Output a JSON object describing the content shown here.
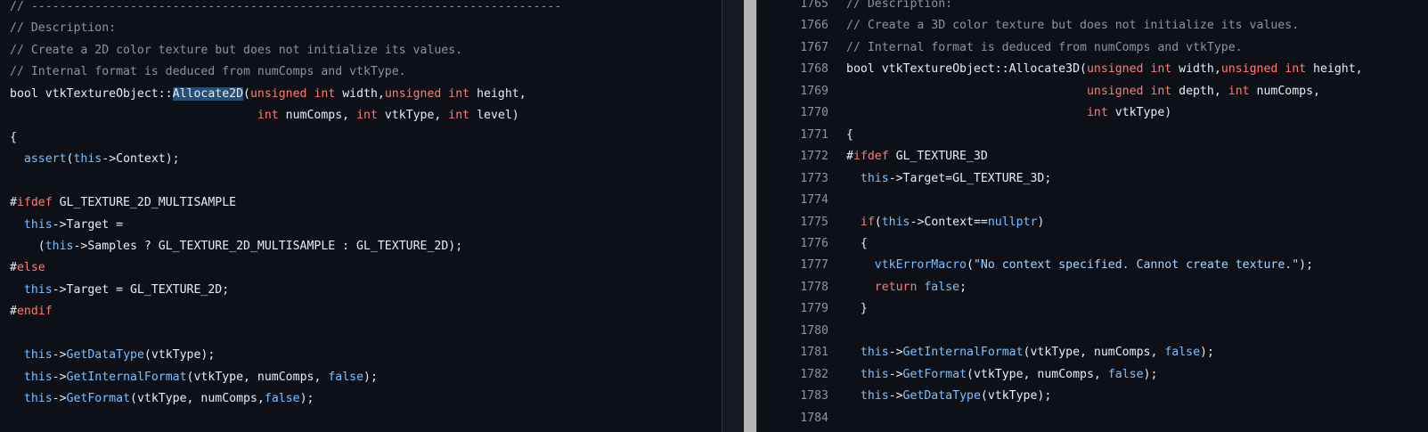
{
  "left_editor": {
    "lines": [
      [
        {
          "t": "// ---------------------------------------------------------------------------",
          "c": "cm"
        }
      ],
      [
        {
          "t": "// Description:",
          "c": "cm"
        }
      ],
      [
        {
          "t": "// Create a 2D color texture but does not initialize its values.",
          "c": "cm"
        }
      ],
      [
        {
          "t": "// Internal format is deduced from numComps and vtkType.",
          "c": "cm"
        }
      ],
      [
        {
          "t": "bool vtkTextureObject::",
          "c": "pl"
        },
        {
          "t": "Allocate2D",
          "c": "hl"
        },
        {
          "t": "(",
          "c": "pl"
        },
        {
          "t": "unsigned int",
          "c": "kw"
        },
        {
          "t": " width,",
          "c": "pl"
        },
        {
          "t": "unsigned int",
          "c": "kw"
        },
        {
          "t": " height,",
          "c": "pl"
        }
      ],
      [
        {
          "t": "                                   ",
          "c": "pl"
        },
        {
          "t": "int",
          "c": "kw"
        },
        {
          "t": " numComps, ",
          "c": "pl"
        },
        {
          "t": "int",
          "c": "kw"
        },
        {
          "t": " vtkType, ",
          "c": "pl"
        },
        {
          "t": "int",
          "c": "kw"
        },
        {
          "t": " level)",
          "c": "pl"
        }
      ],
      [
        {
          "t": "{",
          "c": "pl"
        }
      ],
      [
        {
          "t": "  ",
          "c": "pl"
        },
        {
          "t": "assert",
          "c": "fn"
        },
        {
          "t": "(",
          "c": "pl"
        },
        {
          "t": "this",
          "c": "th"
        },
        {
          "t": "->Context);",
          "c": "pl"
        }
      ],
      [
        {
          "t": "",
          "c": "pl"
        }
      ],
      [
        {
          "t": "#",
          "c": "pl"
        },
        {
          "t": "ifdef",
          "c": "kw"
        },
        {
          "t": " GL_TEXTURE_2D_MULTISAMPLE",
          "c": "pl"
        }
      ],
      [
        {
          "t": "  ",
          "c": "pl"
        },
        {
          "t": "this",
          "c": "th"
        },
        {
          "t": "->Target =",
          "c": "pl"
        }
      ],
      [
        {
          "t": "    (",
          "c": "pl"
        },
        {
          "t": "this",
          "c": "th"
        },
        {
          "t": "->Samples ? GL_TEXTURE_2D_MULTISAMPLE : GL_TEXTURE_2D);",
          "c": "pl"
        }
      ],
      [
        {
          "t": "#",
          "c": "pl"
        },
        {
          "t": "else",
          "c": "kw"
        }
      ],
      [
        {
          "t": "  ",
          "c": "pl"
        },
        {
          "t": "this",
          "c": "th"
        },
        {
          "t": "->Target = GL_TEXTURE_2D;",
          "c": "pl"
        }
      ],
      [
        {
          "t": "#",
          "c": "pl"
        },
        {
          "t": "endif",
          "c": "kw"
        }
      ],
      [
        {
          "t": "",
          "c": "pl"
        }
      ],
      [
        {
          "t": "  ",
          "c": "pl"
        },
        {
          "t": "this",
          "c": "th"
        },
        {
          "t": "->",
          "c": "pl"
        },
        {
          "t": "GetDataType",
          "c": "fn"
        },
        {
          "t": "(vtkType);",
          "c": "pl"
        }
      ],
      [
        {
          "t": "  ",
          "c": "pl"
        },
        {
          "t": "this",
          "c": "th"
        },
        {
          "t": "->",
          "c": "pl"
        },
        {
          "t": "GetInternalFormat",
          "c": "fn"
        },
        {
          "t": "(vtkType, numComps, ",
          "c": "pl"
        },
        {
          "t": "false",
          "c": "th"
        },
        {
          "t": ");",
          "c": "pl"
        }
      ],
      [
        {
          "t": "  ",
          "c": "pl"
        },
        {
          "t": "this",
          "c": "th"
        },
        {
          "t": "->",
          "c": "pl"
        },
        {
          "t": "GetFormat",
          "c": "fn"
        },
        {
          "t": "(vtkType, numComps,",
          "c": "pl"
        },
        {
          "t": "false",
          "c": "th"
        },
        {
          "t": ");",
          "c": "pl"
        }
      ]
    ]
  },
  "right_editor": {
    "lines": [
      {
        "n": "1765",
        "code": [
          {
            "t": "// Description:",
            "c": "cm"
          }
        ]
      },
      {
        "n": "1766",
        "code": [
          {
            "t": "// Create a 3D color texture but does not initialize its values.",
            "c": "cm"
          }
        ]
      },
      {
        "n": "1767",
        "code": [
          {
            "t": "// Internal format is deduced from numComps and vtkType.",
            "c": "cm"
          }
        ]
      },
      {
        "n": "1768",
        "code": [
          {
            "t": "bool vtkTextureObject::Allocate3D(",
            "c": "pl"
          },
          {
            "t": "unsigned int",
            "c": "kw"
          },
          {
            "t": " width,",
            "c": "pl"
          },
          {
            "t": "unsigned int",
            "c": "kw"
          },
          {
            "t": " height,",
            "c": "pl"
          }
        ]
      },
      {
        "n": "1769",
        "code": [
          {
            "t": "                                  ",
            "c": "pl"
          },
          {
            "t": "unsigned int",
            "c": "kw"
          },
          {
            "t": " depth, ",
            "c": "pl"
          },
          {
            "t": "int",
            "c": "kw"
          },
          {
            "t": " numComps,",
            "c": "pl"
          }
        ]
      },
      {
        "n": "1770",
        "code": [
          {
            "t": "                                  ",
            "c": "pl"
          },
          {
            "t": "int",
            "c": "kw"
          },
          {
            "t": " vtkType)",
            "c": "pl"
          }
        ]
      },
      {
        "n": "1771",
        "code": [
          {
            "t": "{",
            "c": "pl"
          }
        ]
      },
      {
        "n": "1772",
        "code": [
          {
            "t": "#",
            "c": "pl"
          },
          {
            "t": "ifdef",
            "c": "kw"
          },
          {
            "t": " GL_TEXTURE_3D",
            "c": "pl"
          }
        ]
      },
      {
        "n": "1773",
        "code": [
          {
            "t": "  ",
            "c": "pl"
          },
          {
            "t": "this",
            "c": "th"
          },
          {
            "t": "->Target=GL_TEXTURE_3D;",
            "c": "pl"
          }
        ]
      },
      {
        "n": "1774",
        "code": [
          {
            "t": "",
            "c": "pl"
          }
        ]
      },
      {
        "n": "1775",
        "code": [
          {
            "t": "  ",
            "c": "pl"
          },
          {
            "t": "if",
            "c": "kw"
          },
          {
            "t": "(",
            "c": "pl"
          },
          {
            "t": "this",
            "c": "th"
          },
          {
            "t": "->Context==",
            "c": "pl"
          },
          {
            "t": "nullptr",
            "c": "th"
          },
          {
            "t": ")",
            "c": "pl"
          }
        ]
      },
      {
        "n": "1776",
        "code": [
          {
            "t": "  {",
            "c": "pl"
          }
        ]
      },
      {
        "n": "1777",
        "code": [
          {
            "t": "    ",
            "c": "pl"
          },
          {
            "t": "vtkErrorMacro",
            "c": "fn"
          },
          {
            "t": "(",
            "c": "pl"
          },
          {
            "t": "\"No context specified. Cannot create texture.\"",
            "c": "st"
          },
          {
            "t": ");",
            "c": "pl"
          }
        ]
      },
      {
        "n": "1778",
        "code": [
          {
            "t": "    ",
            "c": "pl"
          },
          {
            "t": "return",
            "c": "kw"
          },
          {
            "t": " ",
            "c": "pl"
          },
          {
            "t": "false",
            "c": "th"
          },
          {
            "t": ";",
            "c": "pl"
          }
        ]
      },
      {
        "n": "1779",
        "code": [
          {
            "t": "  }",
            "c": "pl"
          }
        ]
      },
      {
        "n": "1780",
        "code": [
          {
            "t": "",
            "c": "pl"
          }
        ]
      },
      {
        "n": "1781",
        "code": [
          {
            "t": "  ",
            "c": "pl"
          },
          {
            "t": "this",
            "c": "th"
          },
          {
            "t": "->",
            "c": "pl"
          },
          {
            "t": "GetInternalFormat",
            "c": "fn"
          },
          {
            "t": "(vtkType, numComps, ",
            "c": "pl"
          },
          {
            "t": "false",
            "c": "th"
          },
          {
            "t": ");",
            "c": "pl"
          }
        ]
      },
      {
        "n": "1782",
        "code": [
          {
            "t": "  ",
            "c": "pl"
          },
          {
            "t": "this",
            "c": "th"
          },
          {
            "t": "->",
            "c": "pl"
          },
          {
            "t": "GetFormat",
            "c": "fn"
          },
          {
            "t": "(vtkType, numComps, ",
            "c": "pl"
          },
          {
            "t": "false",
            "c": "th"
          },
          {
            "t": ");",
            "c": "pl"
          }
        ]
      },
      {
        "n": "1783",
        "code": [
          {
            "t": "  ",
            "c": "pl"
          },
          {
            "t": "this",
            "c": "th"
          },
          {
            "t": "->",
            "c": "pl"
          },
          {
            "t": "GetDataType",
            "c": "fn"
          },
          {
            "t": "(vtkType);",
            "c": "pl"
          }
        ]
      },
      {
        "n": "1784",
        "code": [
          {
            "t": "",
            "c": "pl"
          }
        ]
      }
    ]
  },
  "colors": {
    "background": "#0d1117",
    "comment": "#8b949e",
    "keyword": "#ff7b72",
    "function": "#79c0ff",
    "string": "#a5d6ff",
    "selection": "#264f78",
    "divider": "#b5b5b5"
  }
}
